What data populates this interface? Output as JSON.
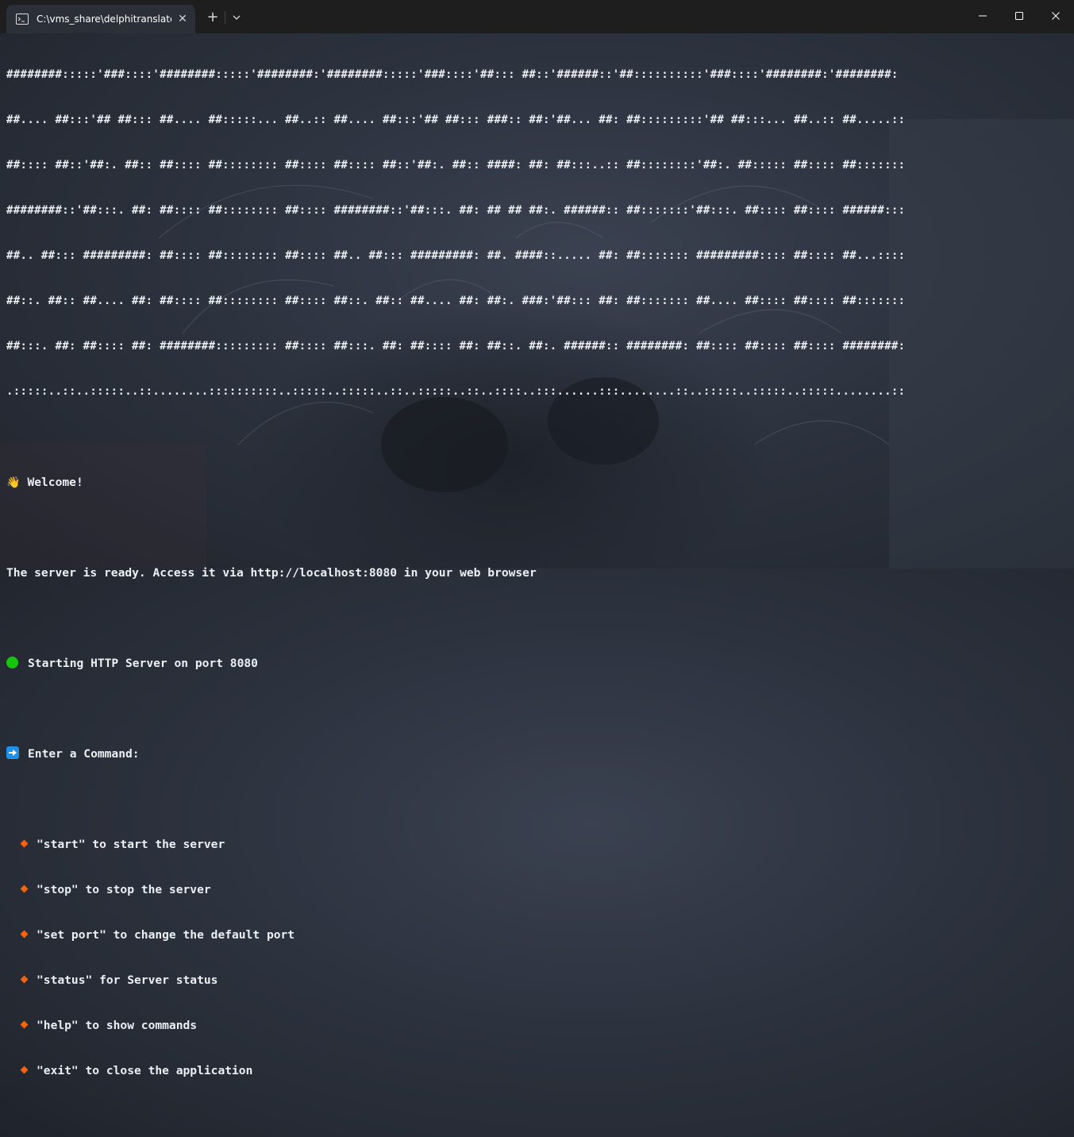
{
  "window": {
    "tab_title": "C:\\vms_share\\delphitranslate\\",
    "tab_close": "✕",
    "new_tab": "+",
    "dropdown": "⌄"
  },
  "terminal": {
    "ascii_art": [
      "########:::::'###::::'########:::::'########:'########:::::'###::::'##::: ##::'######::'##::::::::::'###::::'########:'########:",
      "##.... ##:::'## ##::: ##.... ##:::::... ##..:: ##.... ##:::'## ##::: ###:: ##:'##... ##: ##:::::::::'## ##:::... ##..:: ##.....::",
      "##:::: ##::'##:. ##:: ##:::: ##:::::::: ##:::: ##:::: ##::'##:. ##:: ####: ##: ##:::..:: ##::::::::'##:. ##::::: ##:::: ##:::::::",
      "########::'##:::. ##: ##:::: ##:::::::: ##:::: ########::'##:::. ##: ## ## ##:. ######:: ##:::::::'##:::. ##:::: ##:::: ######:::",
      "##.. ##::: #########: ##:::: ##:::::::: ##:::: ##.. ##::: #########: ##. ####::..... ##: ##::::::: #########:::: ##:::: ##...::::",
      "##::. ##:: ##.... ##: ##:::: ##:::::::: ##:::: ##::. ##:: ##.... ##: ##:. ###:'##::: ##: ##::::::: ##.... ##:::: ##:::: ##:::::::",
      "##:::. ##: ##:::: ##: ########::::::::: ##:::: ##:::. ##: ##:::: ##: ##::. ##:. ######:: ########: ##:::: ##:::: ##:::: ########:",
      ".:::::..::..:::::..::........::::::::::..:::::..:::::..::..:::::..::..::::..:::......:::........::..:::::..:::::..:::::........::"
    ],
    "welcome": "Welcome!",
    "ready": "The server is ready. Access it via http://localhost:8080 in your web browser",
    "starting": "Starting HTTP Server on port 8080",
    "enter": "Enter a Command:",
    "commands": [
      "\"start\" to start the server",
      "\"stop\" to stop the server",
      "\"set port\" to change the default port",
      "\"status\" for Server status",
      "\"help\" to show commands",
      "\"exit\" to close the application"
    ],
    "prompt_input": ""
  },
  "colors": {
    "status_dot": "#16c60c",
    "arrow_badge": "#1e90e6",
    "bullet": "#f7630c"
  }
}
